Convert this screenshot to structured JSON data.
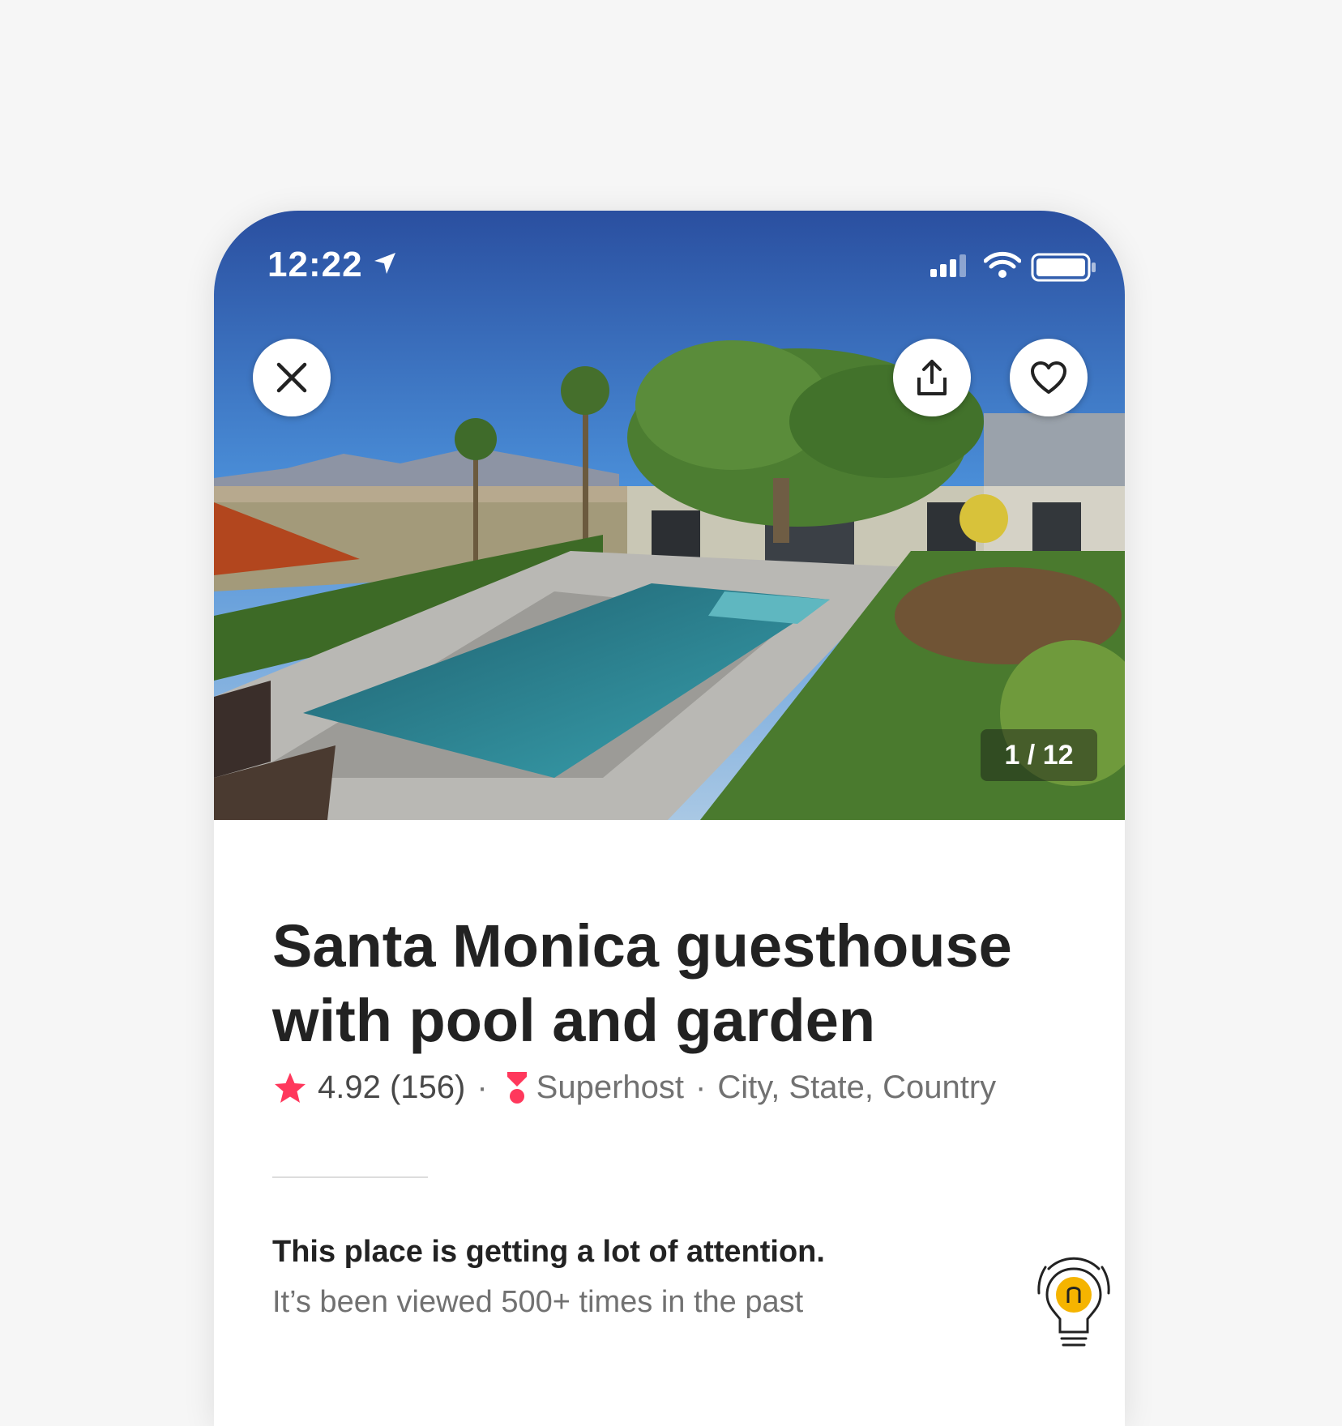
{
  "status_bar": {
    "time": "12:22"
  },
  "hero": {
    "photo_counter": "1 / 12",
    "buttons": {
      "close": "close-icon",
      "share": "share-icon",
      "save": "heart-icon"
    }
  },
  "listing": {
    "title": "Santa Monica guesthouse with pool and garden",
    "rating": "4.92 (156)",
    "host_badge": "Superhost",
    "location": "City, State, Country"
  },
  "notice": {
    "title": "This place is getting a lot of attention.",
    "body": "It’s been viewed 500+ times in the past"
  },
  "colors": {
    "accent": "#FF385C",
    "bulb": "#F5B400",
    "text": "#222222",
    "muted": "#717171"
  }
}
